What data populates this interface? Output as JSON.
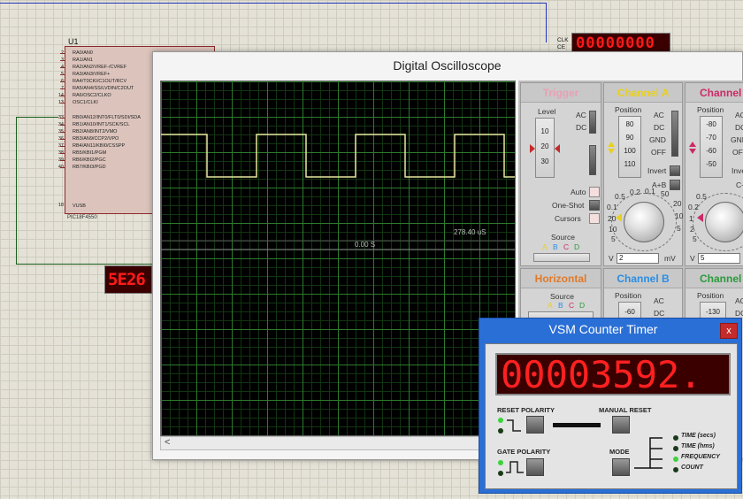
{
  "schematic": {
    "chip_name": "U1",
    "chip_part": "PIC18F4550",
    "chip_ref_tail": "4 5 3",
    "pins_left_top": [
      {
        "num": "2",
        "label": "RA0/AN0"
      },
      {
        "num": "3",
        "label": "RA1/AN1"
      },
      {
        "num": "4",
        "label": "RA2/AN2/VREF-/CVREF"
      },
      {
        "num": "5",
        "label": "RA3/AN3/VREF+"
      },
      {
        "num": "6",
        "label": "RA4/T0CKI/C1OUT/RCV"
      },
      {
        "num": "7",
        "label": "RA5/AN4/SS/LVDIN/C2OUT"
      },
      {
        "num": "14",
        "label": "RA6/OSC2/CLKO"
      },
      {
        "num": "13",
        "label": "OSC1/CLKI"
      }
    ],
    "pins_left_bottom": [
      {
        "num": "33",
        "label": "RB0/AN12/INT0/FLT0/SDI/SDA"
      },
      {
        "num": "34",
        "label": "RB1/AN10/INT1/SCK/SCL"
      },
      {
        "num": "35",
        "label": "RB2/AN8/INT2/VMO"
      },
      {
        "num": "36",
        "label": "RB3/AN9/CCP2/VPO"
      },
      {
        "num": "37",
        "label": "RB4/AN11/KBI0/CSSPP"
      },
      {
        "num": "38",
        "label": "RB5/KBI1/PGM"
      },
      {
        "num": "39",
        "label": "RB6/KBI2/PGC"
      },
      {
        "num": "40",
        "label": "RB7/KBI3/PGD"
      }
    ],
    "pin_vusb": {
      "num": "18",
      "label": "VUSB"
    },
    "display_small": "5E26",
    "display_top": "00000000",
    "clk_label": "CLK",
    "ce_label": "CE"
  },
  "oscilloscope": {
    "title": "Digital Oscilloscope",
    "time_marker": "278.40 uS",
    "origin_label": "0.00 S",
    "scroll_arrow": "<",
    "trigger": {
      "title": "Trigger",
      "level_label": "Level",
      "level_ticks": [
        "10",
        "20",
        "30"
      ],
      "coupling_ac": "AC",
      "coupling_dc": "DC",
      "mode_auto": "Auto",
      "mode_oneshot": "One-Shot",
      "cursors": "Cursors",
      "source_label": "Source",
      "source_options": [
        "A",
        "B",
        "C",
        "D"
      ]
    },
    "channel_a": {
      "title": "Channel A",
      "position_label": "Position",
      "position_ticks": [
        "80",
        "90",
        "100",
        "110"
      ],
      "ac": "AC",
      "dc": "DC",
      "gnd": "GND",
      "off": "OFF",
      "invert": "Invert",
      "aplusb": "A+B",
      "dial_ticks": [
        "0.5",
        "0.2",
        "0.1",
        "50",
        "20",
        "10",
        "5",
        "2",
        "1",
        "0.5",
        "0.2",
        "0.1",
        "20",
        "10",
        "5",
        "2"
      ],
      "volts_label": "V",
      "volts_value": "2",
      "unit_label": "mV"
    },
    "channel_c": {
      "title": "Channel",
      "position_label": "Position",
      "position_ticks": [
        "-80",
        "-70",
        "-60",
        "-50"
      ],
      "ac": "AC",
      "dc": "DC",
      "gnd": "GND",
      "off": "OFF",
      "invert": "Inve",
      "cplusd": "C+",
      "dial_ticks": [
        "0.5",
        "0.2",
        "1",
        "2",
        "5",
        "10",
        "20"
      ],
      "volts_label": "V",
      "volts_value": "5"
    },
    "horizontal": {
      "title": "Horizontal",
      "source_label": "Source",
      "source_options": [
        "A",
        "B",
        "C",
        "D"
      ]
    },
    "channel_b": {
      "title": "Channel B",
      "position_label": "Position",
      "position_tick": "-60",
      "ac": "AC",
      "dc": "DC"
    },
    "channel_d": {
      "title": "Channel",
      "position_label": "Position",
      "position_tick": "-130",
      "ac": "AC",
      "dc": "DC"
    },
    "colors": {
      "trigger": "#e8a0b4",
      "channel_a": "#e8d020",
      "channel_b": "#2a8ee6",
      "channel_c": "#cc2a66",
      "channel_d": "#2a9a3a",
      "horizontal": "#e07a2a",
      "trace": "#e8e8a0"
    }
  },
  "counter_timer": {
    "title": "VSM Counter Timer",
    "close": "x",
    "display": "00003592.",
    "reset_polarity": "RESET POLARITY",
    "manual_reset": "MANUAL RESET",
    "gate_polarity": "GATE POLARITY",
    "mode": "MODE",
    "modes": [
      "TIME (secs)",
      "TIME (hms)",
      "FREQUENCY",
      "COUNT"
    ],
    "active_mode_index": 2
  }
}
